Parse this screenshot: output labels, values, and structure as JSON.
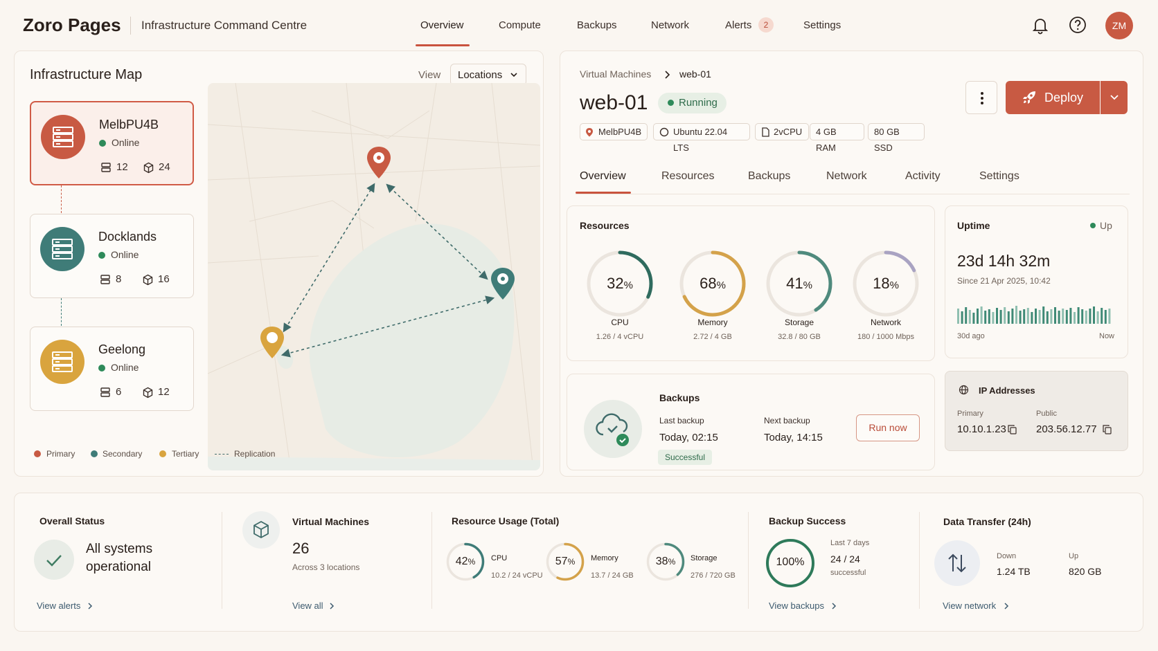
{
  "header": {
    "brand": "Zoro Pages",
    "subtitle": "Infrastructure Command Centre",
    "nav": [
      "Overview",
      "Compute",
      "Backups",
      "Network",
      "Alerts",
      "Settings"
    ],
    "alerts_count": "2",
    "avatar_initials": "ZM"
  },
  "map": {
    "title": "Infrastructure Map",
    "view_label": "View",
    "view_value": "Locations",
    "locations": [
      {
        "name": "MelbPU4B",
        "status": "Online",
        "servers": "12",
        "vms": "24",
        "color": "#c85a43"
      },
      {
        "name": "Docklands",
        "status": "Online",
        "servers": "8",
        "vms": "16",
        "color": "#3f7c78"
      },
      {
        "name": "Geelong",
        "status": "Online",
        "servers": "6",
        "vms": "12",
        "color": "#d9a43e"
      }
    ],
    "legend": [
      "Primary",
      "Secondary",
      "Tertiary",
      "Replication"
    ]
  },
  "vm": {
    "breadcrumb_parent": "Virtual Machines",
    "breadcrumb_current": "web-01",
    "name": "web-01",
    "status": "Running",
    "chips": [
      "MelbPU4B",
      "Ubuntu 22.04 LTS",
      "2vCPU",
      "4 GB RAM",
      "80 GB SSD"
    ],
    "deploy_label": "Deploy",
    "tabs": [
      "Overview",
      "Resources",
      "Backups",
      "Network",
      "Activity",
      "Settings"
    ]
  },
  "resources": {
    "title": "Resources",
    "gauges": [
      {
        "value": "32",
        "label": "CPU",
        "sub": "1.26 / 4 vCPU",
        "pct": 0.32,
        "color": "#2f6b5e"
      },
      {
        "value": "68",
        "label": "Memory",
        "sub": "2.72 / 4 GB",
        "pct": 0.68,
        "color": "#d4a24a"
      },
      {
        "value": "41",
        "label": "Storage",
        "sub": "32.8 / 80 GB",
        "pct": 0.41,
        "color": "#4f8a7d"
      },
      {
        "value": "18",
        "label": "Network",
        "sub": "180 / 1000 Mbps",
        "pct": 0.18,
        "color": "#a9a3c2"
      }
    ],
    "percent_sign": "%"
  },
  "uptime": {
    "title": "Uptime",
    "state": "Up",
    "duration": "23d 14h 32m",
    "since": "Since 21 Apr 2025, 10:42",
    "start_label": "30d ago",
    "end_label": "Now"
  },
  "backups": {
    "title": "Backups",
    "last_label": "Last backup",
    "last_value": "Today, 02:15",
    "next_label": "Next backup",
    "next_value": "Today, 14:15",
    "status": "Successful",
    "run_label": "Run now"
  },
  "ip": {
    "title": "IP Addresses",
    "primary_label": "Primary",
    "primary_value": "10.10.1.23",
    "public_label": "Public",
    "public_value": "203.56.12.77"
  },
  "summary": {
    "overall_title": "Overall Status",
    "overall_line1": "All systems",
    "overall_line2": "operational",
    "overall_link": "View alerts",
    "vm_title": "Virtual Machines",
    "vm_count": "26",
    "vm_sub": "Across 3 locations",
    "vm_link": "View all",
    "usage_title": "Resource Usage (Total)",
    "usage": [
      {
        "value": "42",
        "label": "CPU",
        "sub": "10.2 / 24 vCPU",
        "pct": 0.42,
        "color": "#3f7c78"
      },
      {
        "value": "57",
        "label": "Memory",
        "sub": "13.7 / 24 GB",
        "pct": 0.57,
        "color": "#d4a24a"
      },
      {
        "value": "38",
        "label": "Storage",
        "sub": "276 / 720 GB",
        "pct": 0.38,
        "color": "#4f8a7d"
      }
    ],
    "backup_title": "Backup Success",
    "backup_value": "100%",
    "backup_period": "Last 7 days",
    "backup_count": "24 / 24",
    "backup_note": "successful",
    "backup_link": "View backups",
    "transfer_title": "Data Transfer (24h)",
    "down_label": "Down",
    "down_value": "1.24 TB",
    "up_label": "Up",
    "up_value": "820 GB",
    "transfer_link": "View network"
  }
}
